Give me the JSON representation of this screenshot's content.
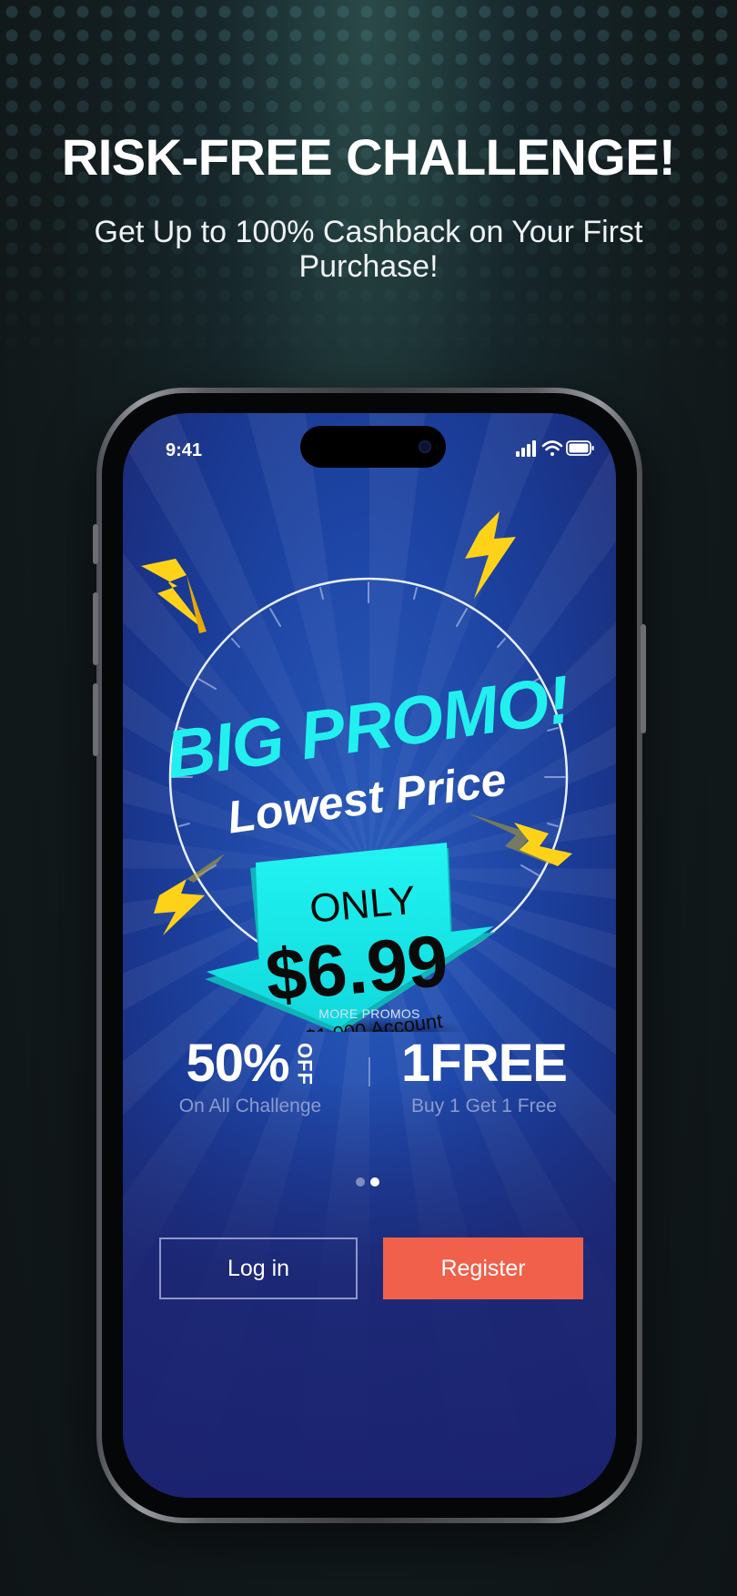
{
  "header": {
    "title": "RISK-FREE CHALLENGE!",
    "subtitle": "Get Up to 100% Cashback on Your First Purchase!"
  },
  "phone": {
    "status_bar": {
      "time": "9:41",
      "icons": [
        "signal-icon",
        "wifi-icon",
        "battery-icon"
      ]
    },
    "promo": {
      "headline": "BIG PROMO!",
      "tagline": "Lowest Price",
      "only_label": "ONLY",
      "price": "$6.99",
      "account_label": "For $1,000 Account"
    },
    "more_promos": {
      "label": "MORE PROMOS",
      "items": [
        {
          "value": "50%",
          "suffix": "OFF",
          "caption": "On All Challenge"
        },
        {
          "value": "1FREE",
          "caption": "Buy 1 Get 1 Free"
        }
      ]
    },
    "pager": {
      "count": 2,
      "active_index": 1
    },
    "buttons": {
      "login_label": "Log in",
      "register_label": "Register"
    }
  },
  "colors": {
    "accent_cyan": "#18f0f0",
    "bolt_yellow": "#ffd21a",
    "register_button": "#f0604a",
    "screen_blue": "#1e47a8"
  }
}
